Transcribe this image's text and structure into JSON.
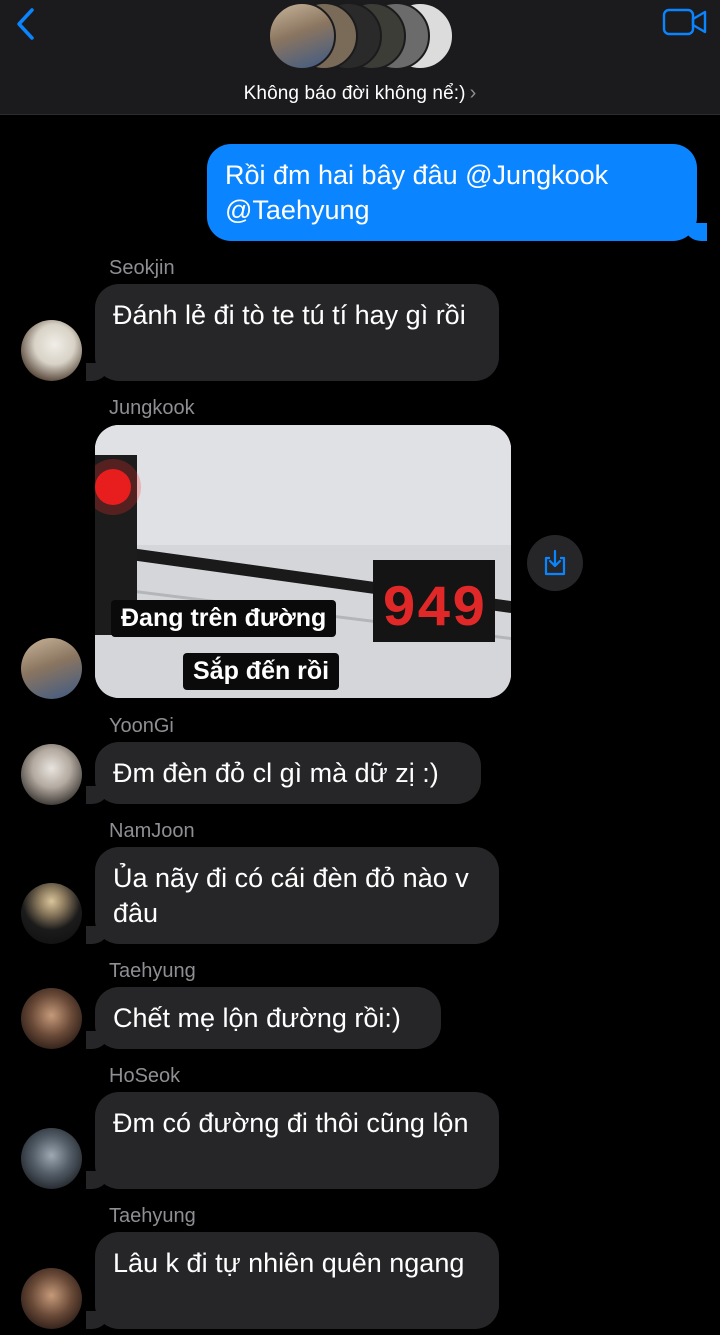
{
  "header": {
    "group_name": "Không báo đời không nể:)",
    "chevron": "›",
    "back_icon": "chevron-left-icon",
    "video_icon": "video-camera-icon"
  },
  "colors": {
    "accent": "#0a84ff",
    "incoming_bubble": "#262628",
    "sender_name": "#8e8e93",
    "background": "#000000"
  },
  "messages": [
    {
      "type": "outgoing",
      "text": "Rồi đm hai bây đâu @Jungkook @Taehyung"
    },
    {
      "type": "incoming",
      "sender": "Seokjin",
      "text": "Đánh lẻ đi tò te tú tí hay gì rồi"
    },
    {
      "type": "incoming-image",
      "sender": "Jungkook",
      "image": {
        "caption_1": "Đang trên đường",
        "caption_2": "Sắp đến rồi",
        "counter": "949"
      }
    },
    {
      "type": "incoming",
      "sender": "YoonGi",
      "text": "Đm đèn đỏ cl gì mà dữ zị :)"
    },
    {
      "type": "incoming",
      "sender": "NamJoon",
      "text": "Ủa nãy đi có cái đèn đỏ nào v đâu"
    },
    {
      "type": "incoming",
      "sender": "Taehyung",
      "text": "Chết mẹ lộn đường rồi:)"
    },
    {
      "type": "incoming",
      "sender": "HoSeok",
      "text": "Đm có đường đi thôi cũng lộn"
    },
    {
      "type": "incoming",
      "sender": "Taehyung",
      "text": "Lâu k đi tự nhiên quên ngang"
    }
  ]
}
